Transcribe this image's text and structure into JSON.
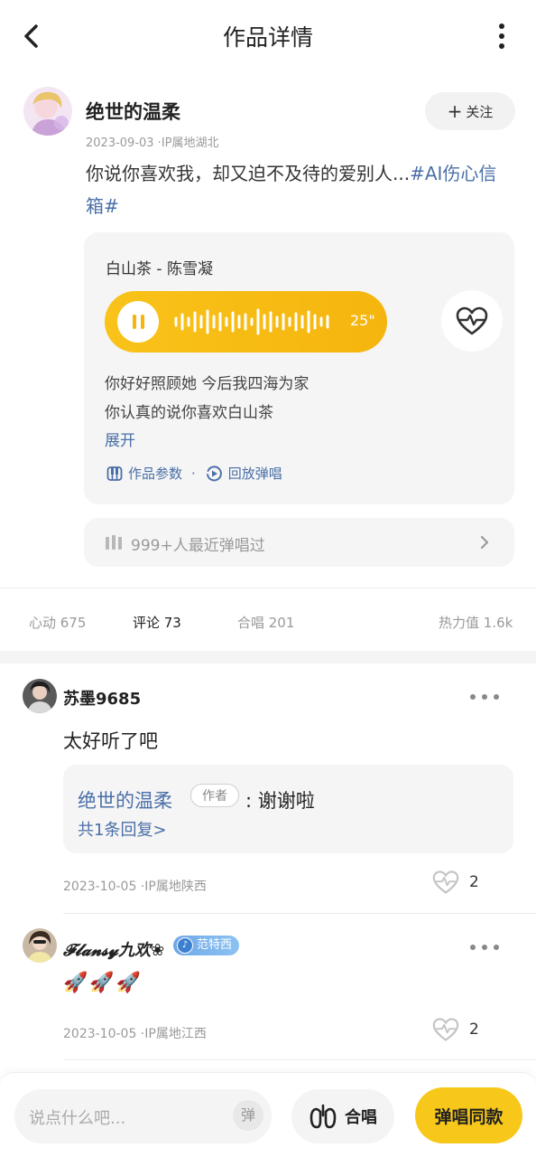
{
  "header": {
    "title": "作品详情"
  },
  "author": {
    "name": "绝世的温柔",
    "meta": "2023-09-03 ·IP属地湖北",
    "follow_label": "关注"
  },
  "post": {
    "text": "你说你喜欢我，却又迫不及待的爱别人...",
    "tag": "#AI伤心信箱#"
  },
  "song": {
    "title": "白山茶 - 陈雪凝",
    "duration": "25\"",
    "lyrics": [
      "你好好照顾她 今后我四海为家",
      "你认真的说你喜欢白山茶"
    ],
    "expand_label": "展开",
    "params_label": "作品参数",
    "replay_label": "回放弹唱",
    "separator": "·"
  },
  "recent": {
    "text": "999+人最近弹唱过"
  },
  "stats": {
    "likes": "心动 675",
    "comments": "评论 73",
    "duets": "合唱 201",
    "heat": "热力值 1.6k"
  },
  "comments": [
    {
      "name": "苏墨9685",
      "text": "太好听了吧",
      "reply": {
        "name": "绝世的温柔",
        "badge": "作者",
        "text": ": 谢谢啦",
        "count": "共1条回复>"
      },
      "meta": "2023-10-05 ·IP属地陕西",
      "likes": "2"
    },
    {
      "name": "𝓕𝓵𝓪𝓷𝓼𝔂九欢❀",
      "badge": "范特西",
      "text": "🚀🚀🚀",
      "meta": "2023-10-05 ·IP属地江西",
      "likes": "2"
    }
  ],
  "bottom": {
    "input_placeholder": "说点什么吧...",
    "danmu_label": "弹",
    "duet_label": "合唱",
    "sing_label": "弹唱同款"
  },
  "colors": {
    "accent": "#f7c81a",
    "link": "#4a6fa8"
  }
}
